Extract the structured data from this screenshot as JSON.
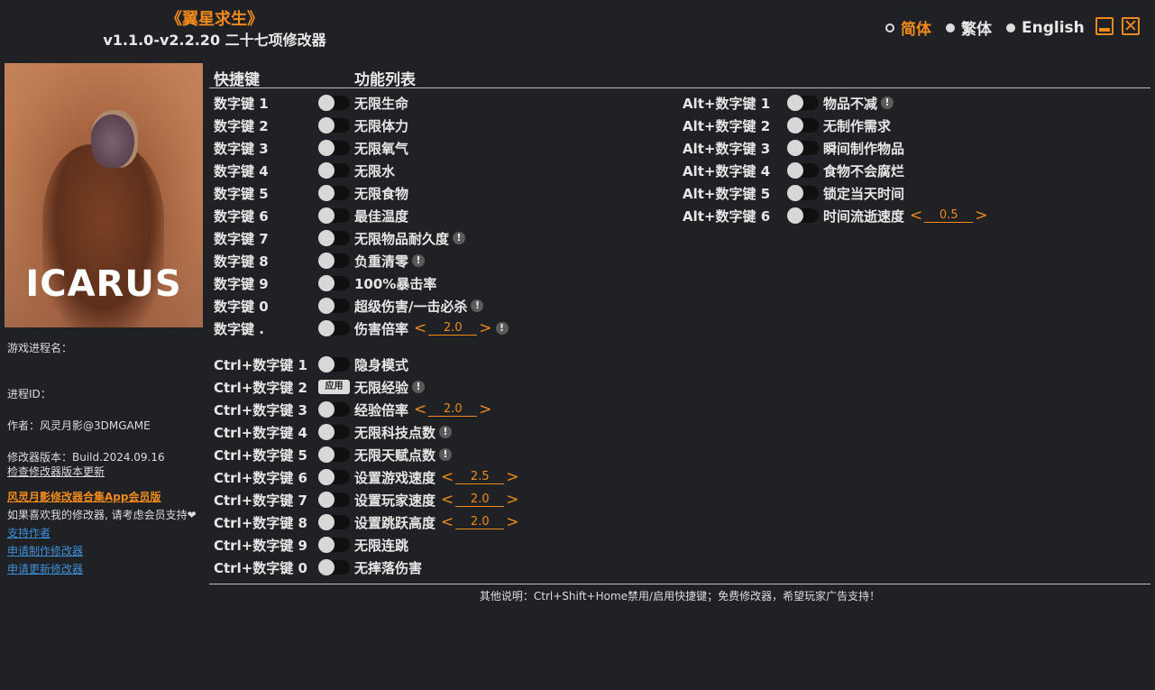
{
  "header": {
    "game_title": "《翼星求生》",
    "subtitle": "v1.1.0-v2.2.20 二十七项修改器"
  },
  "languages": [
    {
      "label": "简体",
      "selected": true
    },
    {
      "label": "繁体",
      "selected": false
    },
    {
      "label": "English",
      "selected": false
    }
  ],
  "window": {
    "minimize_icon": "minimize-icon",
    "close_icon": "close-icon",
    "close_glyph": "✕"
  },
  "cover": {
    "logo_text": "ICARUS"
  },
  "sidebar": {
    "process_name_label": "游戏进程名：",
    "process_id_label": "进程ID：",
    "author": "作者：风灵月影@3DMGAME",
    "version": "修改器版本：Build.2024.09.16",
    "check_update": "检查修改器版本更新",
    "app_promo": "风灵月影修改器合集App会员版",
    "support_text": "如果喜欢我的修改器, 请考虑会员支持❤",
    "support_author": "支持作者",
    "request_make": "申请制作修改器",
    "request_update": "申请更新修改器"
  },
  "columns": {
    "hotkey": "快捷键",
    "features": "功能列表"
  },
  "left_cheats": [
    {
      "key": "数字键 1",
      "name": "无限生命",
      "control": "toggle",
      "info": false
    },
    {
      "key": "数字键 2",
      "name": "无限体力",
      "control": "toggle",
      "info": false
    },
    {
      "key": "数字键 3",
      "name": "无限氧气",
      "control": "toggle",
      "info": false
    },
    {
      "key": "数字键 4",
      "name": "无限水",
      "control": "toggle",
      "info": false
    },
    {
      "key": "数字键 5",
      "name": "无限食物",
      "control": "toggle",
      "info": false
    },
    {
      "key": "数字键 6",
      "name": "最佳温度",
      "control": "toggle",
      "info": false
    },
    {
      "key": "数字键 7",
      "name": "无限物品耐久度",
      "control": "toggle",
      "info": true
    },
    {
      "key": "数字键 8",
      "name": "负重清零",
      "control": "toggle",
      "info": true
    },
    {
      "key": "数字键 9",
      "name": "100%暴击率",
      "control": "toggle",
      "info": false
    },
    {
      "key": "数字键 0",
      "name": "超级伤害/一击必杀",
      "control": "toggle",
      "info": true
    },
    {
      "key": "数字键 .",
      "name": "伤害倍率",
      "control": "toggle",
      "value": "2.0",
      "info": true
    },
    {
      "key": "Ctrl+数字键 1",
      "name": "隐身模式",
      "control": "toggle",
      "info": false
    },
    {
      "key": "Ctrl+数字键 2",
      "name": "无限经验",
      "control": "apply",
      "apply_label": "应用",
      "info": true
    },
    {
      "key": "Ctrl+数字键 3",
      "name": "经验倍率",
      "control": "toggle",
      "value": "2.0",
      "info": false
    },
    {
      "key": "Ctrl+数字键 4",
      "name": "无限科技点数",
      "control": "toggle",
      "info": true
    },
    {
      "key": "Ctrl+数字键 5",
      "name": "无限天赋点数",
      "control": "toggle",
      "info": true
    },
    {
      "key": "Ctrl+数字键 6",
      "name": "设置游戏速度",
      "control": "toggle",
      "value": "2.5",
      "info": false
    },
    {
      "key": "Ctrl+数字键 7",
      "name": "设置玩家速度",
      "control": "toggle",
      "value": "2.0",
      "info": false
    },
    {
      "key": "Ctrl+数字键 8",
      "name": "设置跳跃高度",
      "control": "toggle",
      "value": "2.0",
      "info": false
    },
    {
      "key": "Ctrl+数字键 9",
      "name": "无限连跳",
      "control": "toggle",
      "info": false
    },
    {
      "key": "Ctrl+数字键 0",
      "name": "无摔落伤害",
      "control": "toggle",
      "info": false
    }
  ],
  "right_cheats": [
    {
      "key": "Alt+数字键 1",
      "name": "物品不减",
      "control": "toggle",
      "info": true
    },
    {
      "key": "Alt+数字键 2",
      "name": "无制作需求",
      "control": "toggle",
      "info": false
    },
    {
      "key": "Alt+数字键 3",
      "name": "瞬间制作物品",
      "control": "toggle",
      "info": false
    },
    {
      "key": "Alt+数字键 4",
      "name": "食物不会腐烂",
      "control": "toggle",
      "info": false
    },
    {
      "key": "Alt+数字键 5",
      "name": "锁定当天时间",
      "control": "toggle",
      "info": false
    },
    {
      "key": "Alt+数字键 6",
      "name": "时间流逝速度",
      "control": "toggle",
      "value": "0.5",
      "info": false
    }
  ],
  "glyphs": {
    "info": "!",
    "dec": "<",
    "inc": ">"
  },
  "footer": {
    "note": "其他说明：Ctrl+Shift+Home禁用/启用快捷键；免费修改器，希望玩家广告支持！"
  },
  "colors": {
    "accent": "#f08a1c",
    "link": "#3d8fd8",
    "background": "#202124"
  }
}
